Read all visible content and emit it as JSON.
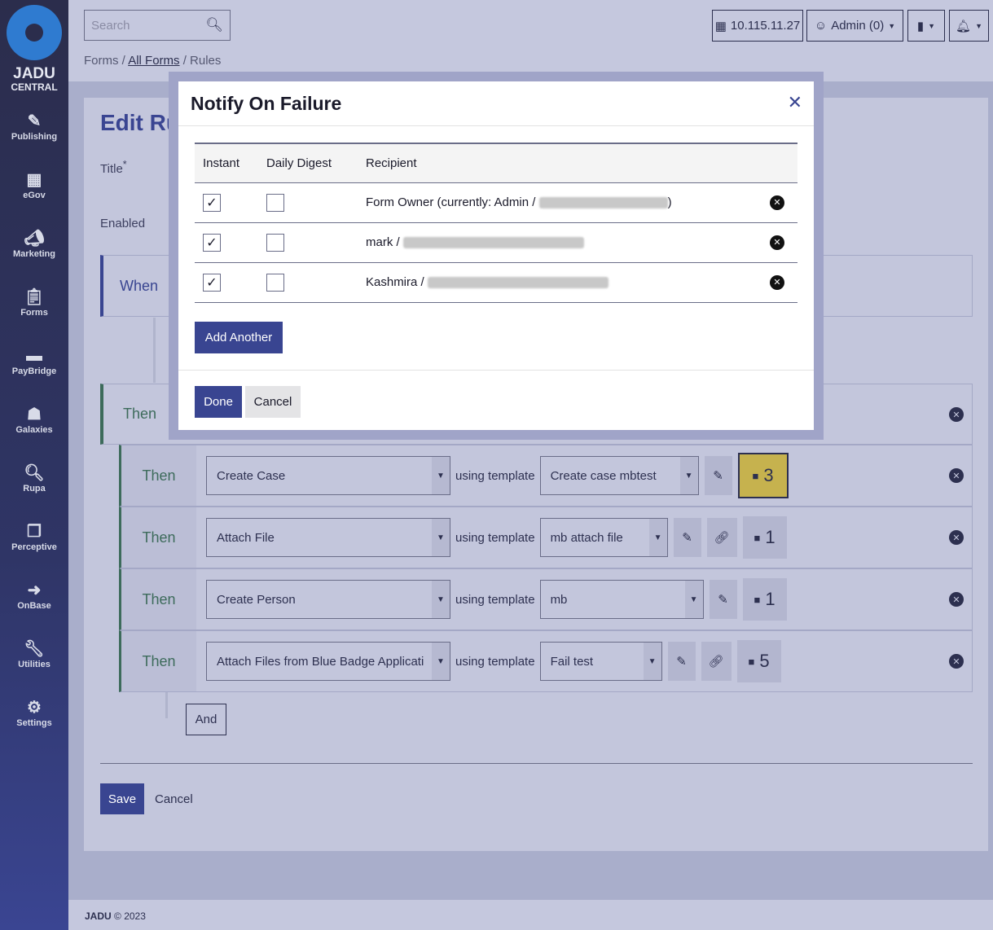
{
  "sidebar": {
    "brand_line1": "JADU",
    "brand_line2": "CENTRAL",
    "items": [
      {
        "label": "Publishing",
        "icon": "pencil-icon"
      },
      {
        "label": "eGov",
        "icon": "building-icon"
      },
      {
        "label": "Marketing",
        "icon": "megaphone-icon"
      },
      {
        "label": "Forms",
        "icon": "clipboard-icon"
      },
      {
        "label": "PayBridge",
        "icon": "credit-card-icon"
      },
      {
        "label": "Galaxies",
        "icon": "sitemap-icon"
      },
      {
        "label": "Rupa",
        "icon": "search-icon"
      },
      {
        "label": "Perceptive",
        "icon": "files-icon"
      },
      {
        "label": "OnBase",
        "icon": "chevron-circle-icon"
      },
      {
        "label": "Utilities",
        "icon": "wrench-icon"
      },
      {
        "label": "Settings",
        "icon": "gear-icon"
      }
    ]
  },
  "header": {
    "search_placeholder": "Search",
    "ip": "10.115.11.27",
    "user": "Admin (0)"
  },
  "breadcrumb": {
    "b1": "Forms",
    "sep": "/",
    "b2": "All Forms",
    "b3": "Rules"
  },
  "page": {
    "title": "Edit Rul",
    "title_label": "Title",
    "required": "*",
    "enabled_label": "Enabled",
    "when": "When",
    "then": "Then",
    "using": "using template",
    "and": "And",
    "save": "Save",
    "cancel": "Cancel"
  },
  "rows": [
    {
      "action": "Create Case",
      "template": "Create case mbtest",
      "link": false,
      "comments": "3",
      "highlight": true
    },
    {
      "action": "Attach File",
      "template": "mb attach file",
      "link": true,
      "comments": "1",
      "highlight": false
    },
    {
      "action": "Create Person",
      "template": "mb",
      "link": false,
      "comments": "1",
      "highlight": false
    },
    {
      "action": "Attach Files from Blue Badge Applicati",
      "template": "Fail test",
      "link": true,
      "comments": "5",
      "highlight": false
    }
  ],
  "modal": {
    "title": "Notify On Failure",
    "headers": [
      "Instant",
      "Daily Digest",
      "Recipient"
    ],
    "recipients": [
      {
        "name": "Form Owner (currently: Admin /",
        "suffix": ")",
        "instant": true,
        "digest": false
      },
      {
        "name": "mark /",
        "suffix": "",
        "instant": true,
        "digest": false
      },
      {
        "name": "Kashmira /",
        "suffix": "",
        "instant": true,
        "digest": false
      }
    ],
    "add": "Add Another",
    "done": "Done",
    "cancel": "Cancel"
  },
  "footer": {
    "brand": "JADU",
    "copy": "© 2023"
  },
  "colors": {
    "primary": "#394591",
    "sidebar": "#2b2d4c",
    "highlight": "#c6b24e",
    "then_accent": "#3d6b5b"
  }
}
